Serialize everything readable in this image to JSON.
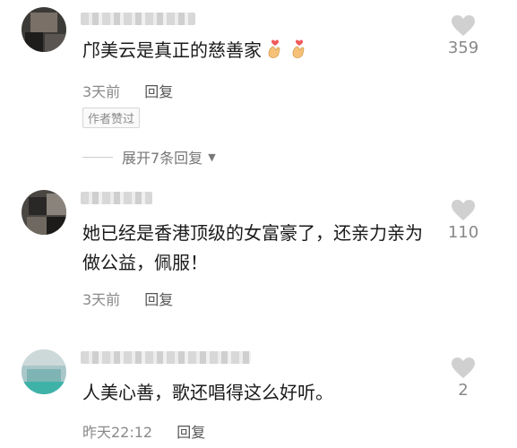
{
  "comments": [
    {
      "text": "邝美云是真正的慈善家",
      "emojis": [
        "finger-heart-emoji",
        "finger-heart-emoji"
      ],
      "time": "3天前",
      "reply_label": "回复",
      "likes": "359",
      "badge": "作者赞过",
      "expand_label": "展开7条回复"
    },
    {
      "text": "她已经是香港顶级的女富豪了，还亲力亲为做公益，佩服！",
      "time": "3天前",
      "reply_label": "回复",
      "likes": "110"
    },
    {
      "text": "人美心善，歌还唱得这么好听。",
      "time": "昨天22:12",
      "reply_label": "回复",
      "likes": "2"
    }
  ],
  "icons": {
    "like": "heart-icon",
    "expand": "chevron-down-icon"
  },
  "colors": {
    "text": "#1a1a1a",
    "meta": "#8a8a8a",
    "heart": "#d0d0d0"
  }
}
